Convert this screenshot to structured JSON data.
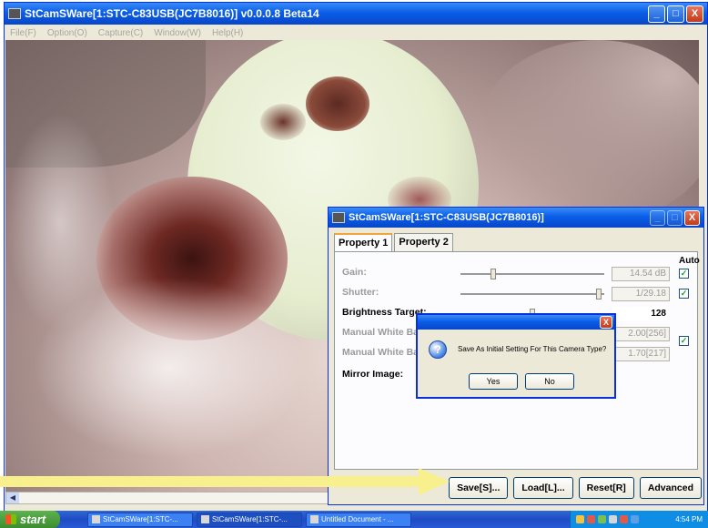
{
  "main_window": {
    "title": "StCamSWare[1:STC-C83USB(JC7B8016)] v0.0.0.8 Beta14",
    "min_label": "_",
    "max_label": "□",
    "close_label": "X",
    "menu": [
      "File(F)",
      "Option(O)",
      "Capture(C)",
      "Window(W)",
      "Help(H)"
    ]
  },
  "settings_window": {
    "title": "StCamSWare[1:STC-C83USB(JC7B8016)]",
    "tabs": [
      "Property 1",
      "Property 2"
    ],
    "auto_label": "Auto",
    "rows": [
      {
        "label": "Gain:",
        "value": "14.54 dB",
        "checked": true,
        "enabled": false,
        "level": 0.22
      },
      {
        "label": "Shutter:",
        "value": "1/29.18",
        "checked": true,
        "enabled": false,
        "level": 0.98
      },
      {
        "label": "Brightness Target:",
        "value": "128",
        "enabled": true,
        "level": 0.5
      },
      {
        "label": "Manual White Bal",
        "value": "2.00[256]",
        "enabled": false
      },
      {
        "label": "Manual White Bal",
        "value": "1.70[217]",
        "enabled": false
      },
      {
        "label": "Mirror Image:",
        "enabled": true
      }
    ],
    "buttons": {
      "save": "Save[S]...",
      "load": "Load[L]...",
      "reset": "Reset[R]",
      "advanced": "Advanced"
    }
  },
  "dialog": {
    "message": "Save As Initial Setting For This Camera Type?",
    "yes": "Yes",
    "no": "No",
    "icon": "question-icon"
  },
  "taskbar": {
    "start": "start",
    "tasks": [
      "StCamSWare[1:STC-...",
      "StCamSWare[1:STC-...",
      "Untitled Document - ..."
    ],
    "clock": "4:54 PM"
  },
  "colors": {
    "arrow": "#f7f08c",
    "titlebar": "#0a5ee8",
    "accent_tab": "#f1a53b"
  }
}
